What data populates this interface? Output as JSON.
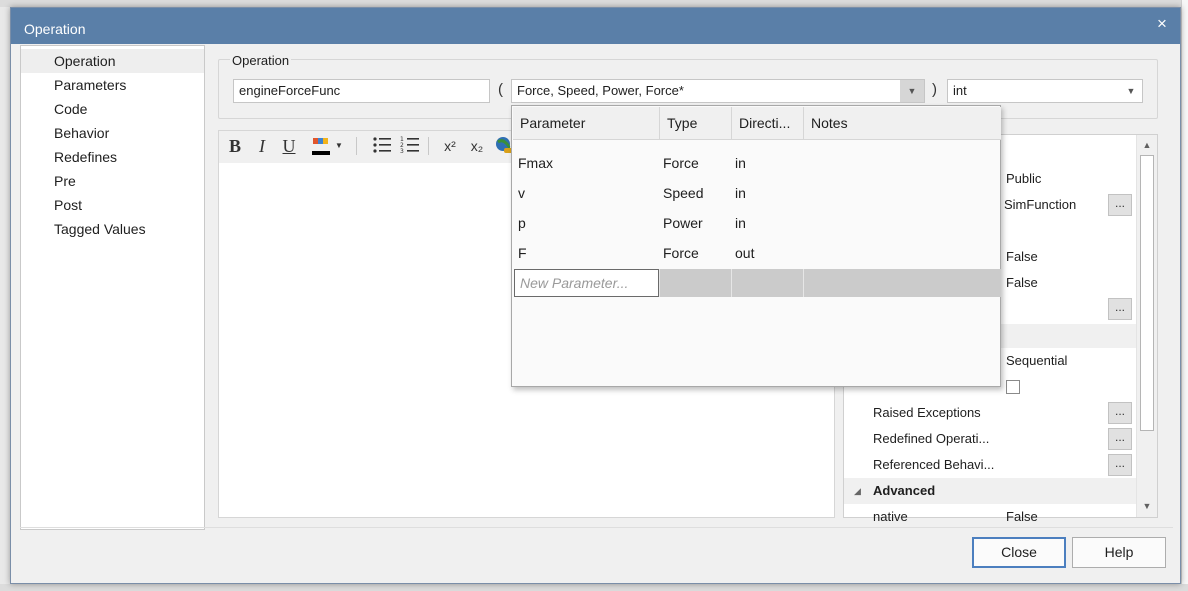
{
  "dialog": {
    "title": "Operation",
    "close_glyph": "×"
  },
  "nav": {
    "items": [
      {
        "label": "Operation",
        "selected": true
      },
      {
        "label": "Parameters"
      },
      {
        "label": "Code"
      },
      {
        "label": "Behavior"
      },
      {
        "label": "Redefines"
      },
      {
        "label": "Pre"
      },
      {
        "label": "Post"
      },
      {
        "label": "Tagged Values"
      }
    ]
  },
  "operation": {
    "group_label": "Operation",
    "name_value": "engineForceFunc",
    "open_paren": "(",
    "close_paren": ")",
    "parameters_summary": "Force, Speed, Power, Force*",
    "return_type": "int"
  },
  "toolbar": {
    "bold": "B",
    "italic": "I",
    "underline": "U",
    "superscript": "x²",
    "subscript": "x₂"
  },
  "params_popup": {
    "headers": [
      "Parameter",
      "Type",
      "Directi...",
      "Notes"
    ],
    "rows": [
      {
        "name": "Fmax",
        "type": "Force",
        "direction": "in",
        "notes": ""
      },
      {
        "name": "v",
        "type": "Speed",
        "direction": "in",
        "notes": ""
      },
      {
        "name": "p",
        "type": "Power",
        "direction": "in",
        "notes": ""
      },
      {
        "name": "F",
        "type": "Force",
        "direction": "out",
        "notes": ""
      }
    ],
    "new_placeholder": "New Parameter..."
  },
  "properties": {
    "rows": [
      {
        "value": "Public"
      },
      {
        "value": "SimFunction",
        "button": "..."
      },
      {
        "value": "False"
      },
      {
        "value": "False"
      },
      {
        "button": "..."
      },
      {
        "value": "Sequential"
      },
      {
        "name": "Raised Exceptions",
        "button": "..."
      },
      {
        "name": "Redefined Operati...",
        "button": "..."
      },
      {
        "name": "Referenced Behavi...",
        "button": "..."
      },
      {
        "category": "Advanced"
      },
      {
        "name": "native",
        "value": "False"
      }
    ],
    "ellipsis": "..."
  },
  "footer": {
    "close_label": "Close",
    "help_label": "Help"
  }
}
